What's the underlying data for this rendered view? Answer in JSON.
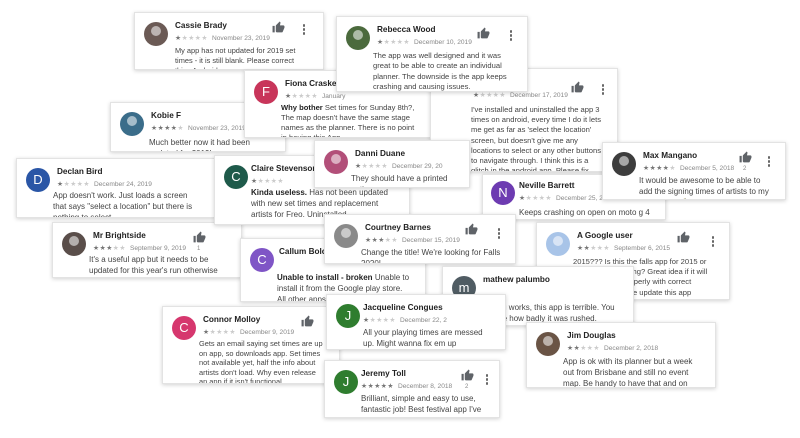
{
  "colors": {
    "avatar_red": "#e0405e",
    "avatar_pink": "#d6376e",
    "avatar_blue": "#2a56a6",
    "avatar_teal": "#1e5a4a",
    "avatar_purple": "#6d3bb1",
    "avatar_violet": "#7f55c6",
    "avatar_slate": "#505c63",
    "avatar_green": "#2f7d2f",
    "avatar_orange": "#e07a3f"
  },
  "reviews": {
    "cassie": {
      "name": "Cassie Brady",
      "stars": "★★★★★",
      "rating": 1,
      "date": "November 23, 2019",
      "text": "My app has not updated for 2019 set times - it is still blank. Please correct this.. Android user"
    },
    "rebecca": {
      "name": "Rebecca Wood",
      "stars": "★★★★★",
      "rating": 1,
      "date": "December 10, 2019",
      "text": "The app was well designed and it was great to be able to create an individual planner. The downside is the app keeps crashing and causing issues."
    },
    "fiona": {
      "name": "Fiona Craske",
      "initial": "F",
      "stars": "★★★★★",
      "rating": 1,
      "date": "January",
      "text_bold": "Why bother",
      "text": "Set times for Sunday 8th?, The map doesn't have the same stage names as the planner. There is no point in having this App"
    },
    "anon1": {
      "stars": "★★★★★",
      "rating": 1,
      "date": "December 17, 2019",
      "text": "I've installed and uninstalled the app 3 times on android, every time I do it lets me get as far as 'select the location' screen, but doesn't give me any locations to select or any other buttons to navigate through. I think this is a glitch in the android app. Please fix before Falls!"
    },
    "kobie": {
      "name": "Kobie F",
      "stars": "★★★★★",
      "rating": 4,
      "date": "November 23, 2019",
      "text": "Much better now it had been updated for 2019!"
    },
    "declan": {
      "name": "Declan Bird",
      "initial": "D",
      "stars": "★★★★★",
      "rating": 1,
      "date": "December 24, 2019",
      "text": "App doesn't work. Just loads a screen that says \"select a location\" but there is nothing to select"
    },
    "claire": {
      "name": "Claire Stevenson",
      "initial": "C",
      "stars": "★★★★★",
      "rating": 1,
      "text_bold": "Kinda useless.",
      "text": "Has not been updated with new set times and replacement artists for Freo. Uninstalled."
    },
    "danni": {
      "name": "Danni Duane",
      "stars": "★★★★★",
      "rating": 1,
      "date": "December 29, 20",
      "text": "They should have a printed option"
    },
    "max": {
      "name": "Max Mangano",
      "stars": "★★★★★",
      "rating": 4,
      "date": "December 5, 2018",
      "thumbs": "2",
      "text": "It would be awesome to be able to add the signing times of artists to my planner! ✌🎸"
    },
    "neville": {
      "name": "Neville Barrett",
      "initial": "N",
      "stars": "★★★★★",
      "rating": 1,
      "date": "December 25, 2",
      "text": "Keeps crashing on open on moto g 4"
    },
    "mrbright": {
      "name": "Mr Brightside",
      "stars": "★★★★★",
      "rating": 3,
      "date": "September 9, 2019",
      "thumbs": "1",
      "text": "It's a useful app but it needs to be updated for this year's run otherwise it's not worth keeping"
    },
    "courtney": {
      "name": "Courtney Barnes",
      "stars": "★★★★★",
      "rating": 3,
      "date": "December 15, 2019",
      "text": "Change the title! We're looking for Falls 2020!"
    },
    "google": {
      "name": "A Google user",
      "stars": "★★★★★",
      "rating": 2,
      "date": "September 6, 2015",
      "text": "2015??? Is this the falls app for 2015 or 2014 very confusing? Great idea if it will be worked out properly with correct information, please update this app"
    },
    "callum": {
      "name": "Callum Bolch",
      "initial": "C",
      "text_bold": "Unable to install - broken",
      "text": "Unable to install it from the Google play store. All other apps work fine."
    },
    "mathew": {
      "name": "mathew palumbo",
      "initial": "m",
      "text": "Nothing works, this app is terrible. You can see how badly it was rushed."
    },
    "connor": {
      "name": "Connor Molloy",
      "initial": "C",
      "stars": "★★★★★",
      "rating": 1,
      "date": "December 9, 2019",
      "text": "Gets an email saying set times are up on app, so downloads app. Set times not available yet, half the info about artists don't load. Why even release an app if it isn't functional"
    },
    "jacqueline": {
      "name": "Jacqueline Congues",
      "initial": "J",
      "stars": "★★★★★",
      "rating": 1,
      "date": "December 22, 2",
      "text": "All your playing times are messed up. Might wanna fix em up"
    },
    "jim": {
      "name": "Jim Douglas",
      "stars": "★★★★★",
      "rating": 2,
      "date": "December 2, 2018",
      "text": "App is ok with its planner but a week out from Brisbane and still no event map. Be handy to have that and on hand info."
    },
    "jeremy": {
      "name": "Jeremy Toll",
      "initial": "J",
      "stars": "★★★★★",
      "rating": 5,
      "date": "December 8, 2018",
      "thumbs": "2",
      "text": "Brilliant, simple and easy to use, fantastic job! Best festival app I've seen!"
    }
  }
}
